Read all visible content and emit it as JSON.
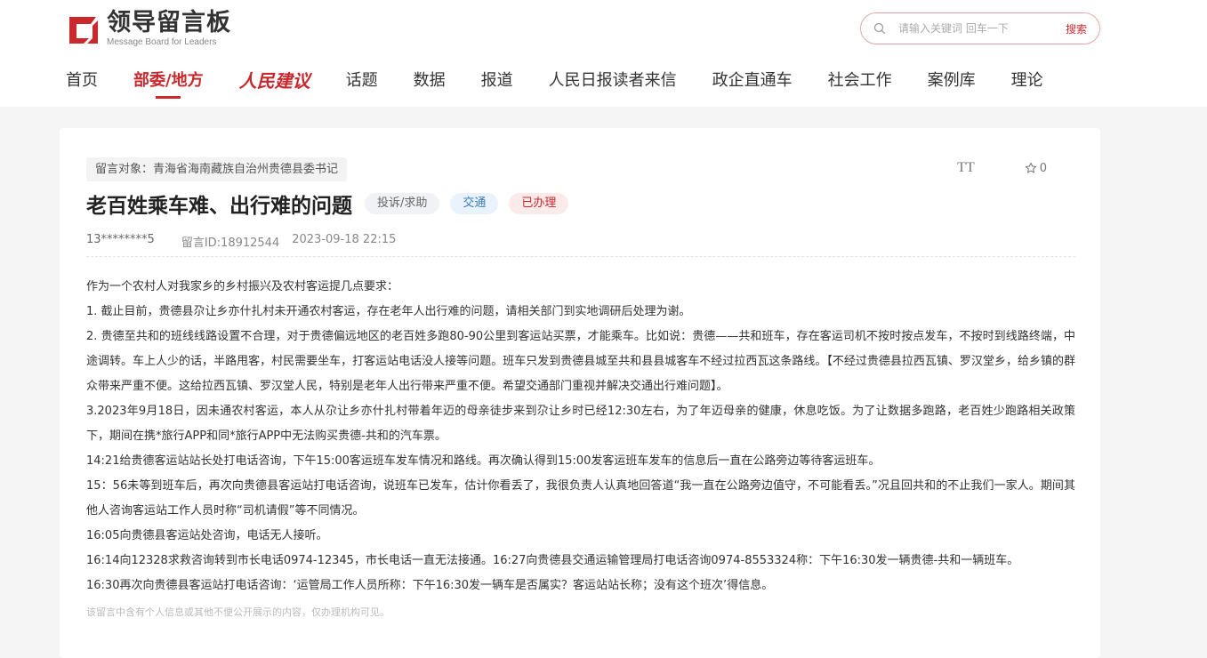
{
  "logo": {
    "name_cn": "领导留言板",
    "name_en": "Message Board for Leaders"
  },
  "search": {
    "placeholder": "请输入关键词 回车一下",
    "button_label": "搜索"
  },
  "nav": {
    "items": [
      "首页",
      "部委/地方",
      "人民建议",
      "话题",
      "数据",
      "报道",
      "人民日报读者来信",
      "政企直通车",
      "社会工作",
      "案例库",
      "理论"
    ]
  },
  "message": {
    "target": "留言对象：青海省海南藏族自治州贵德县委书记",
    "title": "老百姓乘车难、出行难的问题",
    "tags": {
      "type": "投诉/求助",
      "field": "交通",
      "status": "已办理"
    },
    "author": "13********5",
    "message_id": "留言ID:18912544",
    "datetime": "2023-09-18 22:15",
    "favorite_count": "0",
    "font_toggle": "TT",
    "paragraphs": [
      "作为一个农村人对我家乡的乡村振兴及农村客运提几点要求：",
      "1. 截止目前，贵德县尕让乡亦什扎村未开通农村客运，存在老年人出行难的问题，请相关部门到实地调研后处理为谢。",
      "2. 贵德至共和的班线线路设置不合理，对于贵德偏远地区的老百姓多跑80-90公里到客运站买票，才能乘车。比如说：贵德——共和班车，存在客运司机不按时按点发车，不按时到线路终端，中途调转。车上人少的话，半路甩客，村民需要坐车，打客运站电话没人接等问题。班车只发到贵德县城至共和县县城客车不经过拉西瓦这条路线。【不经过贵德县拉西瓦镇、罗汉堂乡，给乡镇的群众带来严重不便。这给拉西瓦镇、罗汉堂人民，特别是老年人出行带来严重不便。希望交通部门重视并解决交通出行难问题】。",
      " 3.2023年9月18日，因未通农村客运，本人从尕让乡亦什扎村带着年迈的母亲徒步来到尕让乡时已经12:30左右，为了年迈母亲的健康，休息吃饭。为了让数据多跑路，老百姓少跑路相关政策下，期间在携*旅行APP和同*旅行APP中无法购买贵德-共和的汽车票。",
      "14:21给贵德客运站站长处打电话咨询，下午15:00客运班车发车情况和路线。再次确认得到15:00发客运班车发车的信息后一直在公路旁边等待客运班车。",
      "15：56未等到班车后，再次向贵德县客运站打电话咨询，说班车已发车，估计你看丢了，我很负责人认真地回答道“我一直在公路旁边值守，不可能看丢。”况且回共和的不止我们一家人。期间其他人咨询客运站工作人员时称“司机请假”等不同情况。",
      "16:05向贵德县客运站处咨询，电话无人接听。",
      "16:14向12328求救咨询转到市长电话0974-12345，市长电话一直无法接通。16:27向贵德县交通运输管理局打电话咨询0974-8553324称：下午16:30发一辆贵德-共和一辆班车。",
      "16:30再次向贵德县客运站打电话咨询：‘运管局工作人员所称：下午16:30发一辆车是否属实？客运站站长称；没有这个班次’得信息。"
    ],
    "privacy_notice": "该留言中含有个人信息或其他不便公开展示的内容，仅办理机构可见。"
  },
  "colors": {
    "brand_red": "#c9282d",
    "tag_blue": "#3a7bbf"
  }
}
